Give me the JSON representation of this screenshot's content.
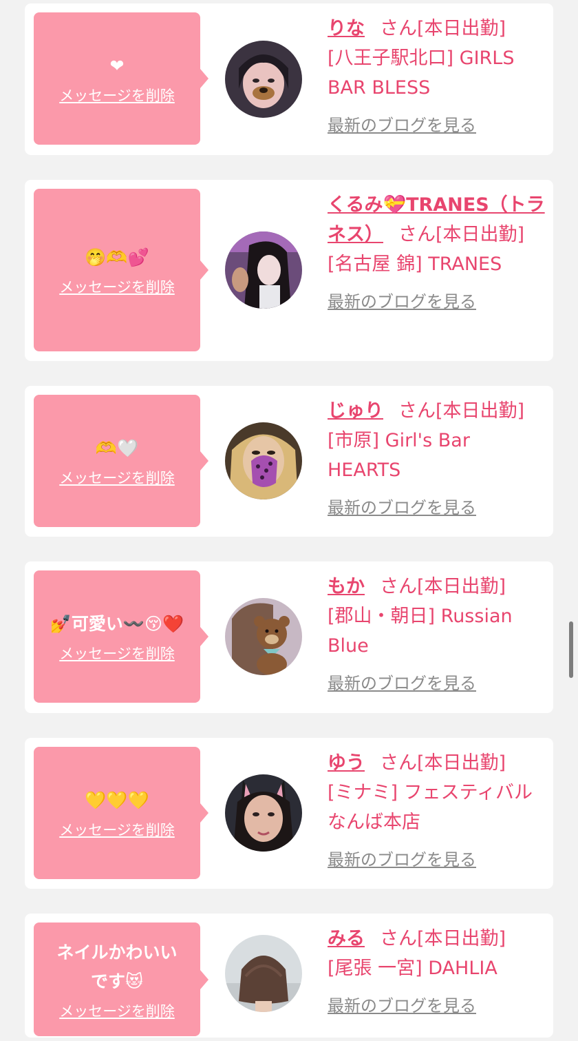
{
  "delete_label": "メッセージを削除",
  "blog_label": "最新のブログを見る",
  "san_suffix": "さん[本日出勤]",
  "colors": {
    "background": "#f2f2f2",
    "card": "#ffffff",
    "bubble": "#fb99aa",
    "name_text": "#e8456e",
    "blog_link": "#8a8a8a"
  },
  "messages": [
    {
      "message": "❤",
      "name": "りな",
      "shop": "[八王子駅北口] GIRLS BAR BLESS",
      "avatar_icon": "girl-with-dog-filter-avatar"
    },
    {
      "message": "🤭🫶💕",
      "name": "くるみ💝TRANES（トラネス）",
      "shop": "[名古屋 錦] TRANES",
      "avatar_icon": "girl-dark-hair-avatar"
    },
    {
      "message": "🫶🤍",
      "name": "じゅり",
      "shop": "[市原] Girl's Bar HEARTS",
      "avatar_icon": "girl-leopard-mask-avatar"
    },
    {
      "message": "💅可愛い〰️😚❤️",
      "name": "もか",
      "shop": "[郡山・朝日] Russian Blue",
      "avatar_icon": "girl-teddy-bear-avatar"
    },
    {
      "message": "💛💛💛",
      "name": "ゆう",
      "shop": "[ミナミ] フェスティバル なんば本店",
      "avatar_icon": "girl-cat-ears-avatar"
    },
    {
      "message": "ネイルかわいいです😻",
      "name": "みる",
      "shop": "[尾張 一宮] DAHLIA",
      "avatar_icon": "girl-bob-hair-avatar"
    }
  ]
}
